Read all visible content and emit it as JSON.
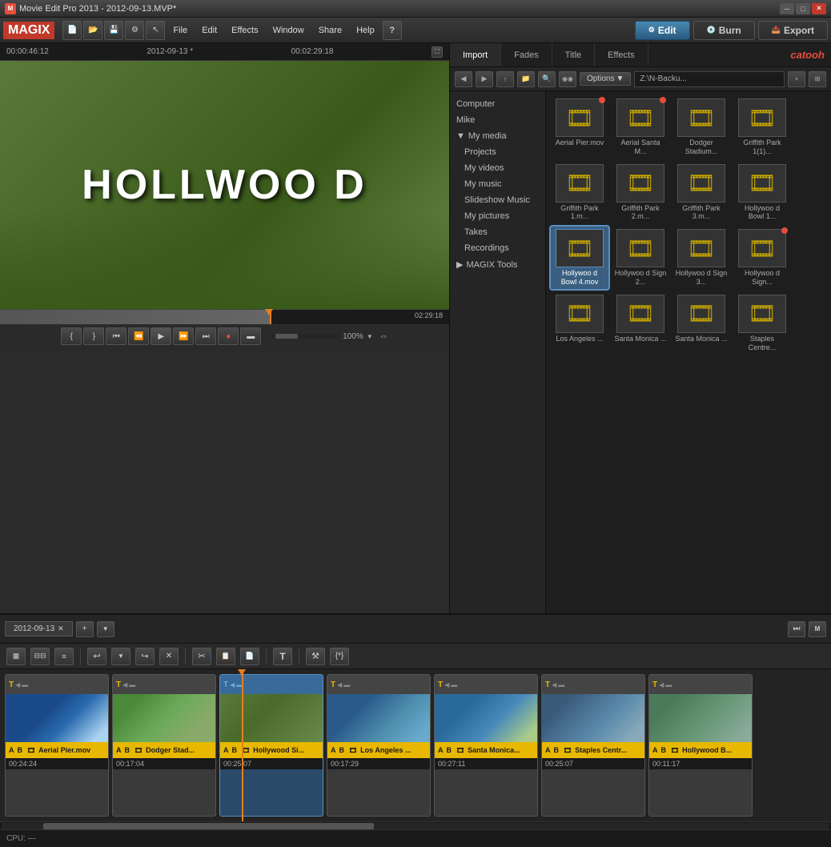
{
  "app": {
    "title": "Movie Edit Pro 2013 - 2012-09-13.MVP*",
    "icon": "M"
  },
  "title_bar": {
    "title": "Movie Edit Pro 2013 - 2012-09-13.MVP*",
    "min_btn": "─",
    "max_btn": "□",
    "close_btn": "✕"
  },
  "menu": {
    "logo": "MAGIX",
    "items": [
      "File",
      "Edit",
      "Effects",
      "Window",
      "Share",
      "Help"
    ],
    "help_icon": "?"
  },
  "top_actions": {
    "edit_label": "Edit",
    "burn_label": "Burn",
    "export_label": "Export"
  },
  "preview": {
    "time_start": "00:00:46:12",
    "date": "2012-09-13 *",
    "time_end": "00:02:29:18",
    "sign_text": "HOLLWOO D",
    "current_time": "02:29:18"
  },
  "transport": {
    "zoom_pct": "100%"
  },
  "right_panel": {
    "tabs": [
      "Import",
      "Fades",
      "Title",
      "Effects"
    ],
    "active_tab": "Import",
    "catooh": "catooh",
    "options_label": "Options",
    "path": "Z:\\N-Backu..."
  },
  "file_tree": {
    "items": [
      {
        "label": "Computer",
        "indent": 0
      },
      {
        "label": "Mike",
        "indent": 0
      },
      {
        "label": "My media",
        "indent": 0,
        "has_arrow": true
      },
      {
        "label": "Projects",
        "indent": 1
      },
      {
        "label": "My videos",
        "indent": 1
      },
      {
        "label": "My music",
        "indent": 1
      },
      {
        "label": "Slideshow Music",
        "indent": 1
      },
      {
        "label": "My pictures",
        "indent": 1
      },
      {
        "label": "Takes",
        "indent": 1
      },
      {
        "label": "Recordings",
        "indent": 1
      },
      {
        "label": "MAGIX Tools",
        "indent": 0,
        "has_arrow": true
      }
    ]
  },
  "file_grid": {
    "items": [
      {
        "name": "Aerial Pier.mov",
        "has_dot": true,
        "row": 1
      },
      {
        "name": "Aerial Santa M...",
        "has_dot": true,
        "row": 1
      },
      {
        "name": "Dodger Stadium...",
        "has_dot": false,
        "row": 1
      },
      {
        "name": "Griffith Park 1(1)...",
        "has_dot": false,
        "row": 1
      },
      {
        "name": "Griffith Park 1.m...",
        "has_dot": false,
        "row": 2
      },
      {
        "name": "Griffith Park 2.m...",
        "has_dot": false,
        "row": 2
      },
      {
        "name": "Griffith Park 3.m...",
        "has_dot": false,
        "row": 2
      },
      {
        "name": "Hollywoo d Bowl 1...",
        "has_dot": false,
        "row": 2
      },
      {
        "name": "Hollywoo d Bowl 4.mov",
        "has_dot": false,
        "row": 3,
        "selected": true
      },
      {
        "name": "Hollywoo d Sign 2...",
        "has_dot": false,
        "row": 3
      },
      {
        "name": "Hollywoo d Sign 3...",
        "has_dot": false,
        "row": 3
      },
      {
        "name": "Hollywoo d Sign...",
        "has_dot": true,
        "row": 3
      },
      {
        "name": "Los Angeles ...",
        "has_dot": false,
        "row": 4
      },
      {
        "name": "Santa Monica ...",
        "has_dot": false,
        "row": 4
      },
      {
        "name": "Santa Monica ...",
        "has_dot": false,
        "row": 4
      },
      {
        "name": "Staples Centre...",
        "has_dot": false,
        "row": 4
      }
    ]
  },
  "timeline": {
    "tab_name": "2012-09-13",
    "clips": [
      {
        "name": "Aerial Pier.mov",
        "duration": "00:24:24",
        "style": "aerial-pier",
        "active": false
      },
      {
        "name": "Dodger Stad...",
        "duration": "00:17:04",
        "style": "dodger-stadium",
        "active": false
      },
      {
        "name": "Hollywood Si...",
        "duration": "00:25:07",
        "style": "hollywood-sign-clip",
        "active": true
      },
      {
        "name": "Los Angeles ...",
        "duration": "00:17:29",
        "style": "la-clip",
        "active": false
      },
      {
        "name": "Santa Monica...",
        "duration": "00:27:11",
        "style": "santa-monica",
        "active": false
      },
      {
        "name": "Staples Centr...",
        "duration": "00:25:07",
        "style": "staples",
        "active": false
      },
      {
        "name": "Hollywood B...",
        "duration": "00:11:17",
        "style": "hollywood-bowl",
        "active": false
      }
    ]
  },
  "status_bar": {
    "cpu": "CPU: —"
  }
}
